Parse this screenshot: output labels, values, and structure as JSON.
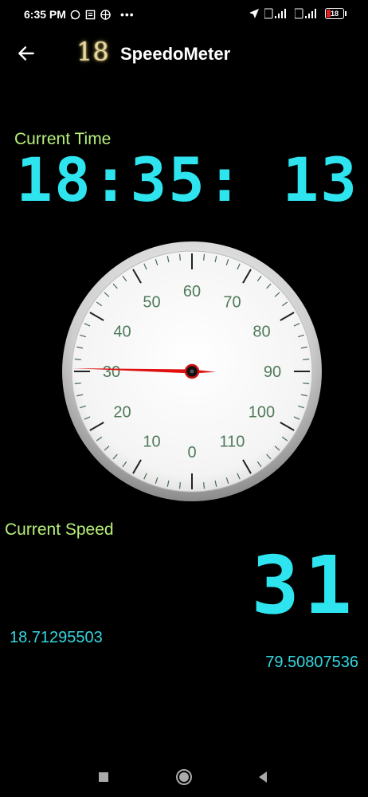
{
  "status_bar": {
    "time": "6:35 PM",
    "dots": "•••",
    "battery": "18"
  },
  "app_bar": {
    "logo": "18",
    "title": "SpeedoMeter"
  },
  "time_section": {
    "label": "Current Time",
    "value": "18:35: 13"
  },
  "speedometer": {
    "tick_labels": [
      "0",
      "10",
      "20",
      "30",
      "40",
      "50",
      "60",
      "70",
      "80",
      "90",
      "100",
      "110"
    ],
    "needle_value": 30,
    "needle_color": "#e01010",
    "label_color": "#4f7a5a"
  },
  "speed_section": {
    "label": "Current Speed",
    "value": "31"
  },
  "coordinates": {
    "latitude": "18.71295503",
    "longitude": "79.50807536"
  }
}
